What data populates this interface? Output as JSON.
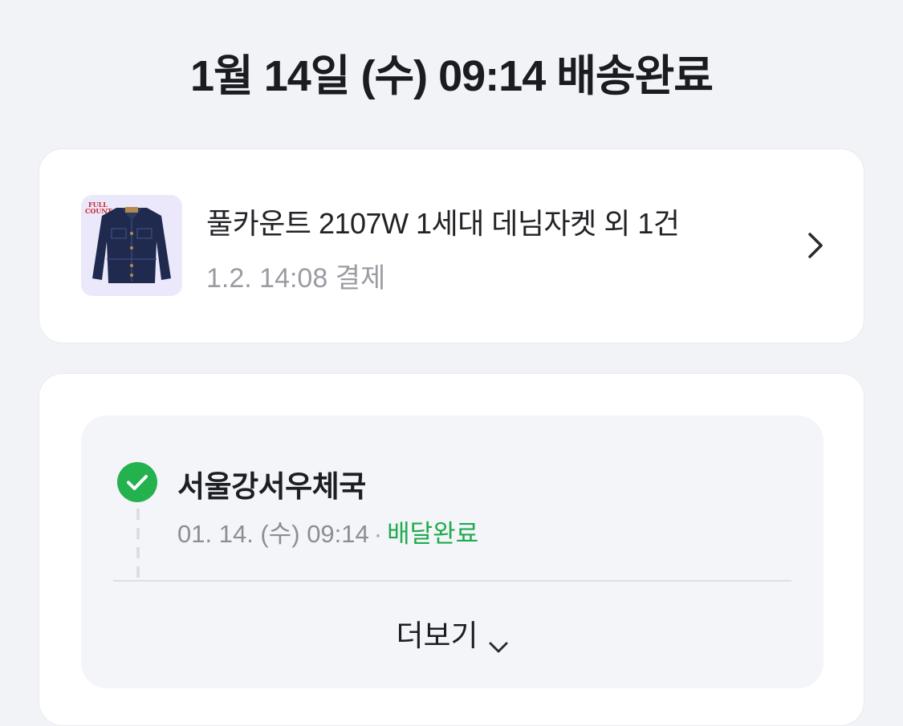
{
  "headline": "1월 14일 (수) 09:14 배송완료",
  "order": {
    "thumbnail_brand": "FULL COUNT",
    "title": "풀카운트 2107W 1세대 데님자켓 외 1건",
    "paid_at": "1.2. 14:08 결제",
    "detail_icon": "chevron-right-icon"
  },
  "tracking": {
    "station": "서울강서우체국",
    "time": "01. 14. (수) 09:14",
    "separator": "·",
    "status": "배달완료",
    "status_icon": "check-circle-icon",
    "more_label": "더보기",
    "more_icon": "chevron-down-icon"
  },
  "colors": {
    "background": "#f2f3f6",
    "card": "#ffffff",
    "status_green": "#1fab4f",
    "check_green": "#24b24e",
    "muted_text": "#9a9ca2",
    "thumbnail_bg": "#ece8fb"
  }
}
